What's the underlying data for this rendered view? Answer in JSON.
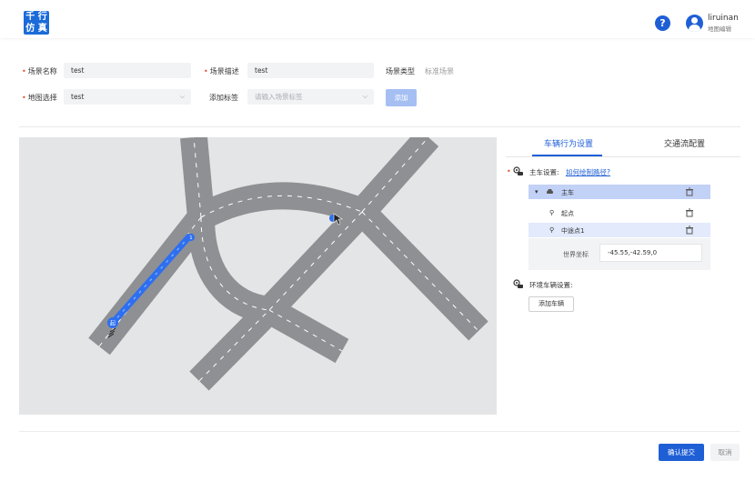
{
  "header": {
    "logo_chars": [
      "千",
      "行",
      "仿",
      "真"
    ],
    "help_label": "?",
    "user_name": "liruinan",
    "user_role": "地图编辑"
  },
  "form": {
    "scene_name_label": "场景名称",
    "scene_name_value": "test",
    "scene_desc_label": "场景描述",
    "scene_desc_value": "test",
    "scene_type_label": "场景类型",
    "scene_type_value": "标准场景",
    "map_select_label": "地图选择",
    "map_select_value": "test",
    "add_tag_label": "添加标签",
    "add_tag_placeholder": "请输入场景标签",
    "add_button": "添加"
  },
  "map": {
    "start_marker": "起",
    "ego_marker": "1"
  },
  "tabs": {
    "vehicle_behavior": "车辆行为设置",
    "traffic_flow": "交通流配置"
  },
  "ego": {
    "title": "主车设置:",
    "help_link": "如何绘制路径?",
    "tree_root": "主车",
    "start_point": "起点",
    "waypoint": "中途点1",
    "world_coord_label": "世界坐标",
    "world_coord_value": "-45.55,-42.59,0"
  },
  "env": {
    "title": "环境车辆设置:",
    "add_vehicle": "添加车辆"
  },
  "footer": {
    "confirm": "确认提交",
    "cancel": "取消"
  }
}
